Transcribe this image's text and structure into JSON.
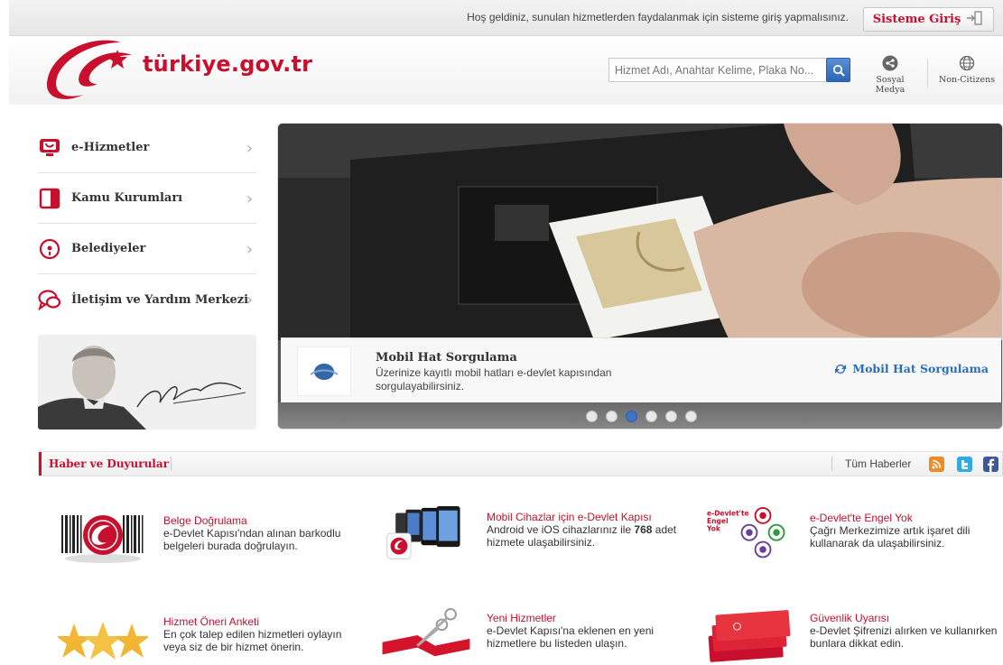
{
  "topbar": {
    "welcome": "Hoş geldiniz, sunulan hizmetlerden faydalanmak için sisteme giriş yapmalısınız.",
    "login_label": "Sisteme Giriş"
  },
  "header": {
    "logo_text": "türkiye.gov.tr",
    "search_placeholder": "Hizmet Adı, Anahtar Kelime, Plaka No...",
    "social_label": "Sosyal Medya",
    "noncitizens_label": "Non-Citizens"
  },
  "menu": {
    "items": [
      {
        "label": "e-Hizmetler",
        "icon": "monitor-icon"
      },
      {
        "label": "Kamu Kurumları",
        "icon": "building-icon"
      },
      {
        "label": "Belediyeler",
        "icon": "location-pin-icon"
      },
      {
        "label": "İletişim ve Yardım Merkezi",
        "icon": "chat-icon"
      }
    ]
  },
  "slider": {
    "title": "Mobil Hat Sorgulama",
    "description": "Üzerinize kayıtlı mobil hatları e-devlet kapısından sorgulayabilirsiniz.",
    "link": "Mobil Hat Sorgulama",
    "dot_count": 6,
    "active_dot": 3
  },
  "news": {
    "header": "Haber ve Duyurular",
    "all_news": "Tüm Haberler",
    "items": [
      {
        "title": "Belge Doğrulama",
        "desc": "e-Devlet Kapısı'ndan alınan barkodlu belgeleri burada doğrulayın."
      },
      {
        "title": "Mobil Cihazlar için e-Devlet Kapısı",
        "desc_pre": "Android ve iOS cihazlarınız ile ",
        "desc_bold": "768",
        "desc_post": " adet hizmete ulaşabilirsiniz."
      },
      {
        "title": "e-Devlet'te Engel Yok",
        "desc": "Çağrı Merkezimize artık işaret dili kullanarak da ulaşabilirsiniz."
      },
      {
        "title": "Hizmet Öneri Anketi",
        "desc": "En çok talep edilen hizmetleri oylayın veya siz de bir hizmet önerin."
      },
      {
        "title": "Yeni Hizmetler",
        "desc": "e-Devlet Kapısı'na eklenen en yeni hizmetlere bu listeden ulaşın."
      },
      {
        "title": "Güvenlik Uyarısı",
        "desc": "e-Devlet Şifrenizi alırken ve kullanırken bunlara dikkat edin."
      }
    ]
  },
  "thumb_text": {
    "engel_line1": "e-Devlet'te",
    "engel_line2": "Engel",
    "engel_line3": "Yok"
  },
  "colors": {
    "brand_red": "#c8102e",
    "link_blue": "#2a6ebb",
    "active_dot": "#3f74c2"
  }
}
